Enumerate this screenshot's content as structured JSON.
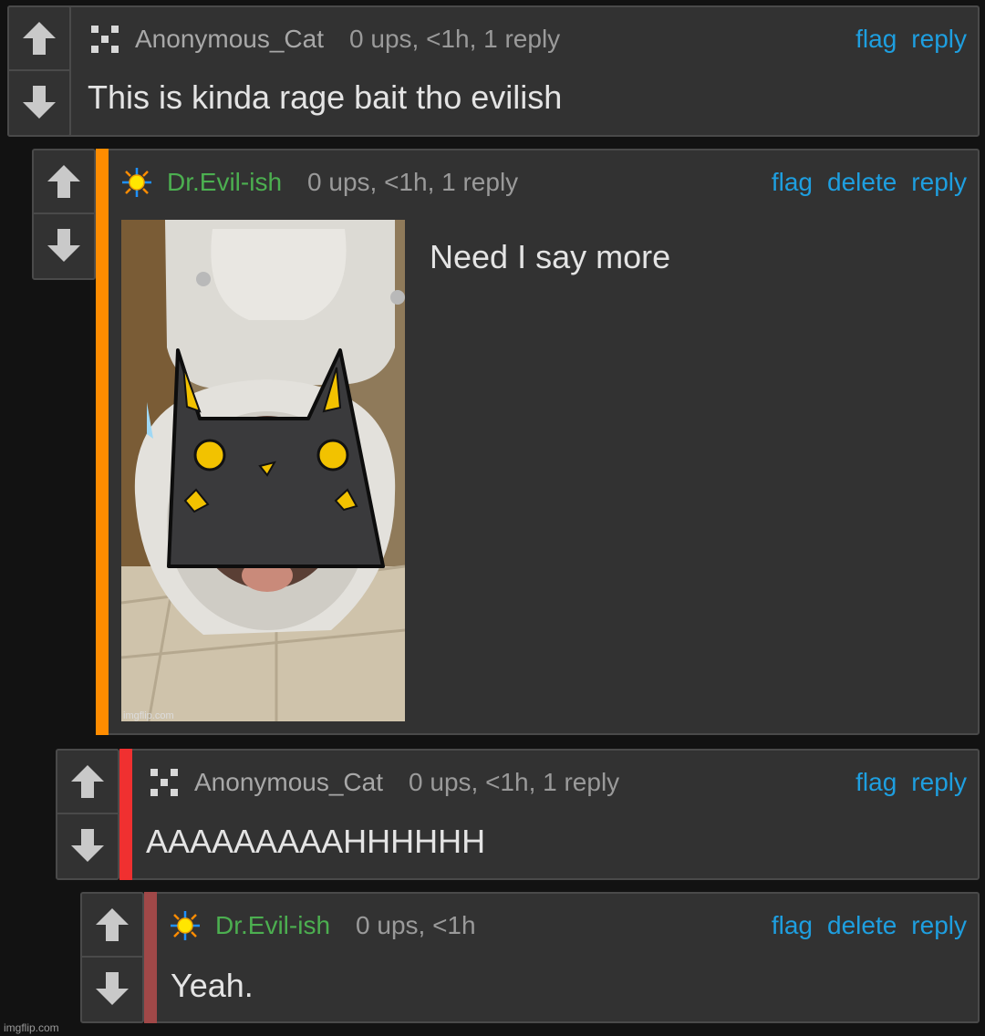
{
  "comments": [
    {
      "username": "Anonymous_Cat",
      "meta": "0 ups, <1h, 1 reply",
      "actions": [
        "flag",
        "reply"
      ],
      "text": "This is kinda rage bait tho evilish",
      "avatar_icon": "pixel-avatar-icon"
    },
    {
      "username": "Dr.Evil-ish",
      "meta": "0 ups, <1h, 1 reply",
      "actions": [
        "flag",
        "delete",
        "reply"
      ],
      "text": "Need I say more",
      "avatar_icon": "sun-avatar-icon",
      "thread_color": "#ff8c00",
      "image_watermark": "imgflip.com"
    },
    {
      "username": "Anonymous_Cat",
      "meta": "0 ups, <1h, 1 reply",
      "actions": [
        "flag",
        "reply"
      ],
      "text": "AAAAAAAAAHHHHHH",
      "avatar_icon": "pixel-avatar-icon",
      "thread_color": "#f03030"
    },
    {
      "username": "Dr.Evil-ish",
      "meta": "0 ups, <1h",
      "actions": [
        "flag",
        "delete",
        "reply"
      ],
      "text": "Yeah.",
      "avatar_icon": "sun-avatar-icon",
      "thread_color": "#a04848"
    }
  ],
  "footer_watermark": "imgflip.com",
  "colors": {
    "background": "#121212",
    "panel": "#323232",
    "link": "#1e9fe0",
    "username_green": "#4caf50"
  }
}
